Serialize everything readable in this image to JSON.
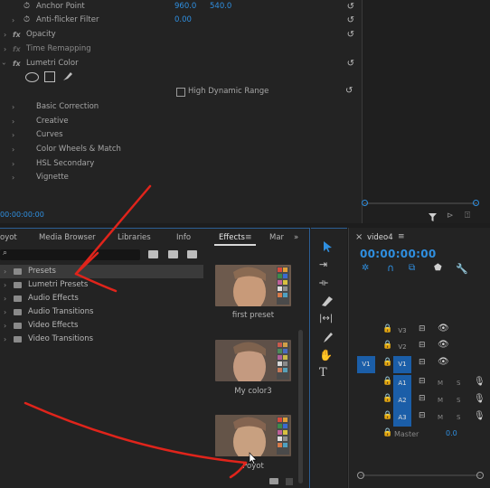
{
  "effect_controls": {
    "rows": [
      {
        "label": "Anchor Point",
        "value1": "960.0",
        "value2": "540.0"
      },
      {
        "label": "Anti-flicker Filter",
        "value1": "0.00"
      }
    ],
    "effects": [
      "Opacity",
      "Time Remapping",
      "Lumetri Color"
    ],
    "hdr_label": "High Dynamic Range",
    "lumetri_sections": [
      "Basic Correction",
      "Creative",
      "Curves",
      "Color Wheels & Match",
      "HSL Secondary",
      "Vignette"
    ],
    "timecode": "00:00:00:00"
  },
  "panel": {
    "tabs": [
      "oyot",
      "Media Browser",
      "Libraries",
      "Info",
      "Effects",
      "Mar"
    ],
    "active_tab": "Effects",
    "tree": [
      "Presets",
      "Lumetri Presets",
      "Audio Effects",
      "Audio Transitions",
      "Video Effects",
      "Video Transitions"
    ],
    "previews": [
      "first preset",
      "My color3",
      "Poyot"
    ]
  },
  "timeline": {
    "sequence_name": "video4",
    "timecode": "00:00:00:00",
    "video_tracks": [
      "V3",
      "V2",
      "V1"
    ],
    "source_patch": "V1",
    "audio_tracks": [
      "A1",
      "A2",
      "A3"
    ],
    "master_label": "Master",
    "master_value": "0.0",
    "mute_label": "M",
    "solo_label": "S"
  },
  "colors": {
    "value_blue": "#2f8fe0",
    "selection_blue": "#1b5ea8",
    "annotation_red": "#e0241b"
  },
  "icons": [
    "reset-icon",
    "stopwatch-icon",
    "ellipse-mask-icon",
    "rect-mask-icon",
    "pen-mask-icon",
    "search-icon",
    "new-bin-icon",
    "selection-tool-icon",
    "razor-tool-icon",
    "hand-tool-icon",
    "type-tool-icon",
    "lock-icon",
    "eye-icon",
    "mic-icon",
    "wrench-icon"
  ]
}
